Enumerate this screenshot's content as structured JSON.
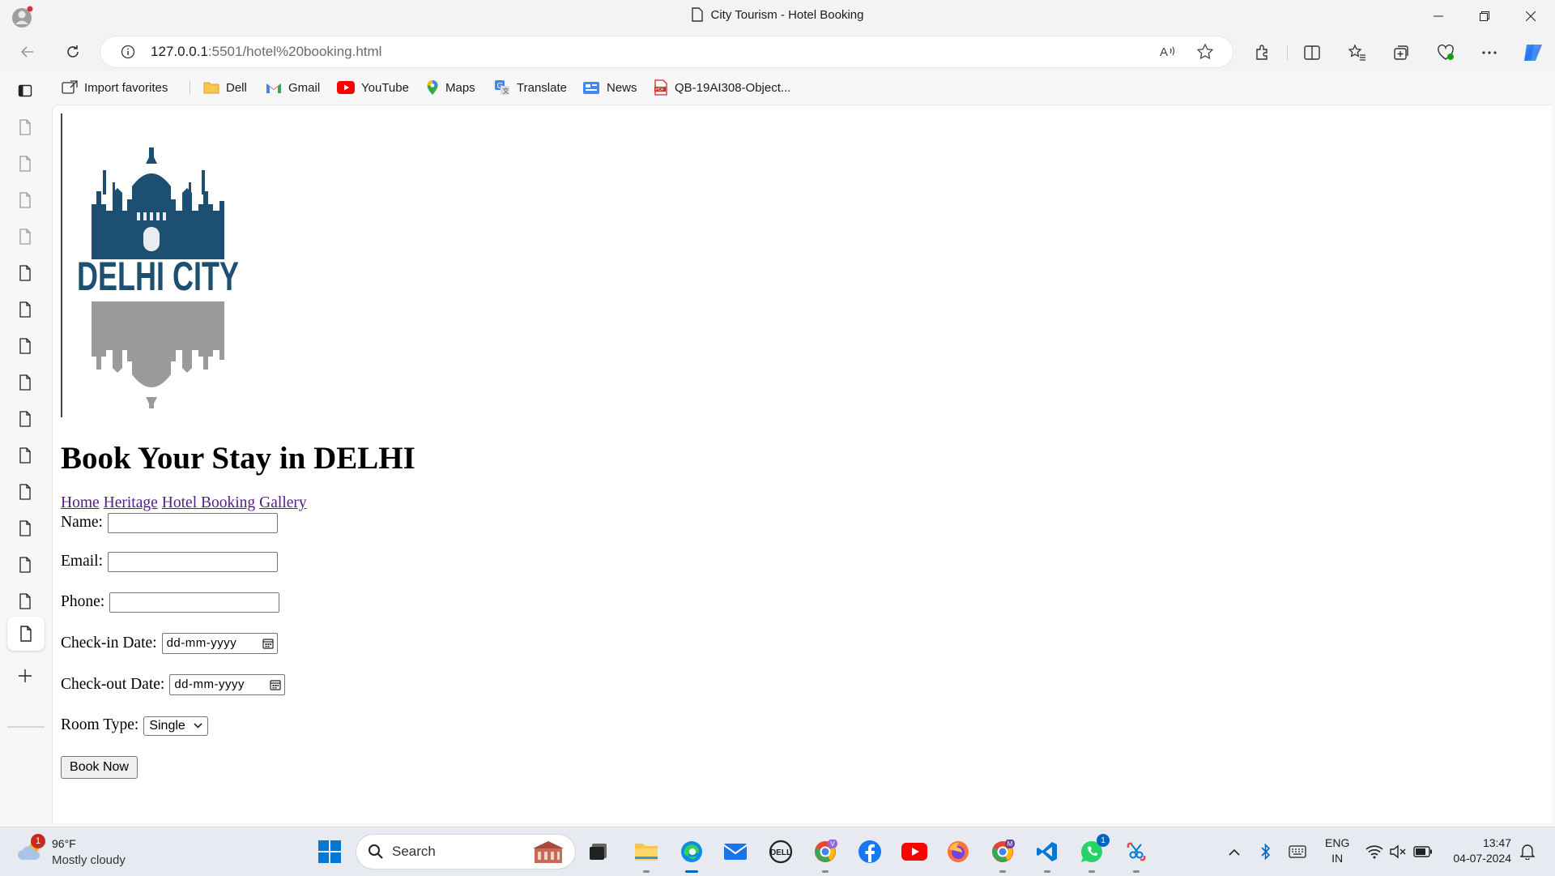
{
  "window": {
    "title": "City Tourism - Hotel Booking"
  },
  "address": {
    "host": "127.0.0.1",
    "rest": ":5501/hotel%20booking.html"
  },
  "favorites": [
    {
      "label": "Import favorites",
      "icon": "import-icon"
    },
    {
      "label": "Dell",
      "icon": "folder-icon"
    },
    {
      "label": "Gmail",
      "icon": "gmail-icon"
    },
    {
      "label": "YouTube",
      "icon": "youtube-icon"
    },
    {
      "label": "Maps",
      "icon": "maps-pin-icon"
    },
    {
      "label": "Translate",
      "icon": "translate-icon"
    },
    {
      "label": "News",
      "icon": "news-icon"
    },
    {
      "label": "QB-19AI308-Object...",
      "icon": "pdf-icon"
    }
  ],
  "page": {
    "logo_text": "DELHI CITY",
    "heading": "Book Your Stay in DELHI",
    "nav": {
      "home": "Home",
      "heritage": "Heritage",
      "hotel_booking": "Hotel Booking",
      "gallery": "Gallery"
    },
    "form": {
      "name_label": "Name:",
      "email_label": "Email:",
      "phone_label": "Phone:",
      "checkin_label": "Check-in Date:",
      "checkin_placeholder": "dd-mm-yyyy",
      "checkout_label": "Check-out Date:",
      "checkout_placeholder": "dd-mm-yyyy",
      "room_label": "Room Type:",
      "room_value": "Single",
      "submit_label": "Book Now"
    }
  },
  "taskbar": {
    "weather": {
      "temp": "96°F",
      "desc": "Mostly cloudy",
      "badge": "1"
    },
    "search_label": "Search",
    "whatsapp_badge": "1",
    "language": {
      "line1": "ENG",
      "line2": "IN"
    },
    "clock": {
      "time": "13:47",
      "date": "04-07-2024"
    }
  },
  "colors": {
    "accent": "#0067c0",
    "link_visited": "#551a8b",
    "logo_blue": "#1d4f73",
    "logo_gray": "#9a9a9a"
  }
}
